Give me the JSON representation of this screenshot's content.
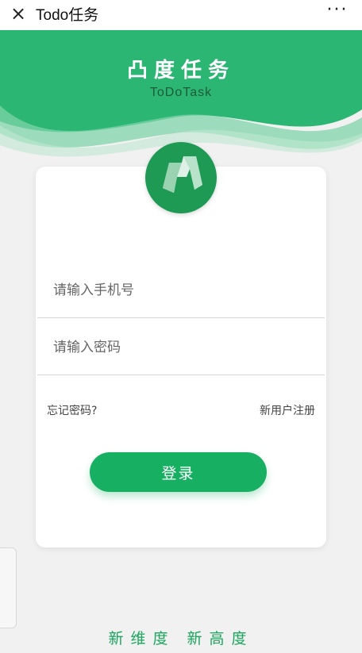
{
  "window": {
    "title": "Todo任务",
    "close_icon": "×",
    "more_icon": "···"
  },
  "header": {
    "brand_title": "凸度任务",
    "brand_subtitle": "ToDoTask"
  },
  "colors": {
    "primary_green": "#17b062",
    "header_green": "#2bb673",
    "slogan_green": "#1aa55c"
  },
  "form": {
    "phone_placeholder": "请输入手机号",
    "password_placeholder": "请输入密码",
    "forgot_label": "忘记密码?",
    "register_label": "新用户注册",
    "login_label": "登录"
  },
  "footer": {
    "slogan": "新维度 新高度"
  }
}
